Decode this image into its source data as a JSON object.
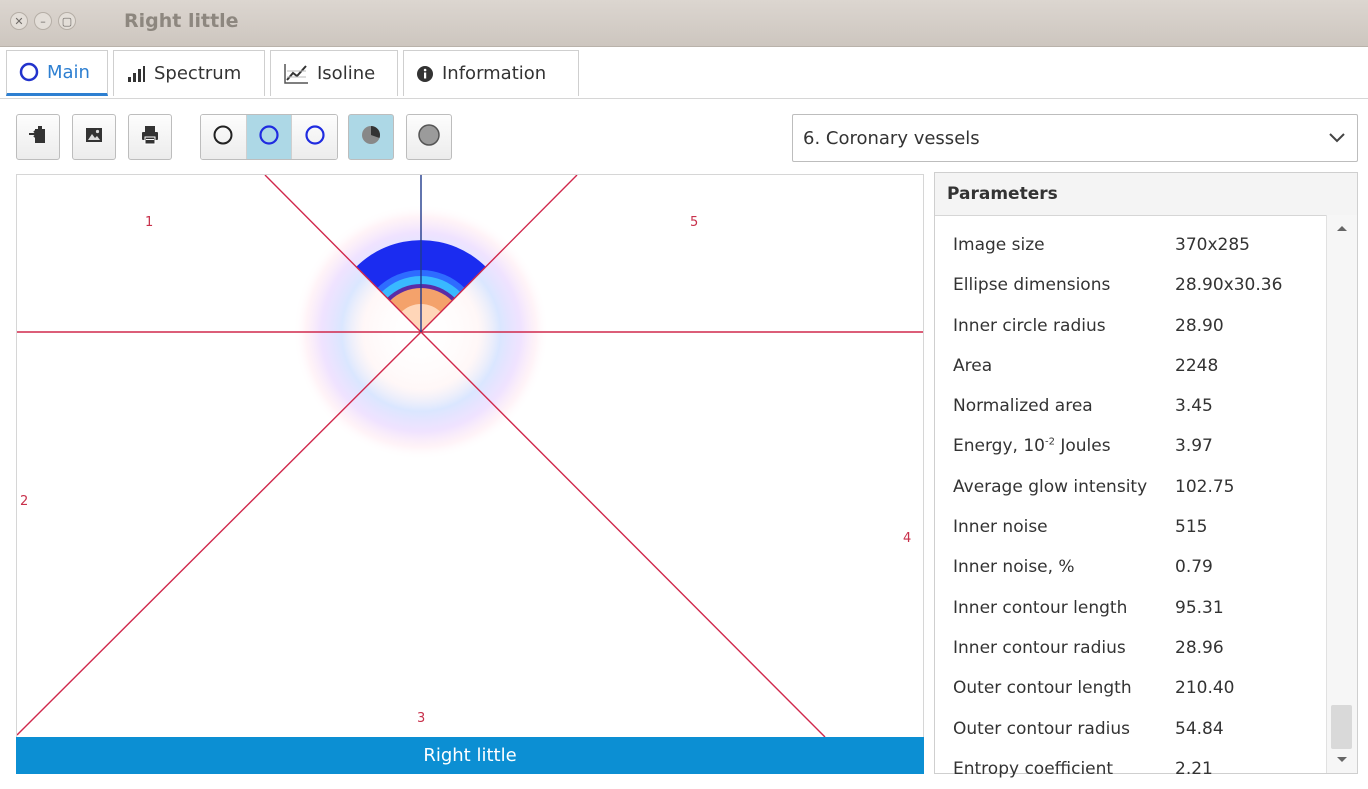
{
  "window": {
    "title": "Right little"
  },
  "tabs": [
    {
      "label": "Main",
      "icon": "circle-outline-icon",
      "active": true
    },
    {
      "label": "Spectrum",
      "icon": "bar-chart-icon",
      "active": false
    },
    {
      "label": "Isoline",
      "icon": "line-chart-icon",
      "active": false
    },
    {
      "label": "Information",
      "icon": "info-icon",
      "active": false
    }
  ],
  "toolbar": {
    "buttons": [
      "export-icon",
      "image-icon",
      "print-icon"
    ],
    "ring_modes": [
      "black-ring",
      "blue-ring-selected",
      "blue-ring"
    ],
    "toggles": [
      "pie-sector-icon",
      "filled-circle-icon"
    ]
  },
  "organ_select": {
    "value": "6. Coronary vessels"
  },
  "canvas": {
    "sector_labels": [
      "1",
      "5",
      "2",
      "4",
      "3"
    ],
    "footer_label": "Right little"
  },
  "parameters": {
    "title": "Parameters",
    "rows": [
      {
        "label": "Image size",
        "value": "370x285"
      },
      {
        "label": "Ellipse dimensions",
        "value": "28.90x30.36"
      },
      {
        "label": "Inner circle radius",
        "value": "28.90"
      },
      {
        "label": "Area",
        "value": "2248"
      },
      {
        "label": "Normalized area",
        "value": "3.45"
      },
      {
        "label": "Energy, 10",
        "label_sup": "-2",
        "label_suffix": " Joules",
        "value": "3.97"
      },
      {
        "label": "Average glow intensity",
        "value": "102.75"
      },
      {
        "label": "Inner noise",
        "value": "515"
      },
      {
        "label": "Inner noise, %",
        "value": "0.79"
      },
      {
        "label": "Inner contour length",
        "value": "95.31"
      },
      {
        "label": "Inner contour radius",
        "value": "28.96"
      },
      {
        "label": "Outer contour length",
        "value": "210.40"
      },
      {
        "label": "Outer contour radius",
        "value": "54.84"
      },
      {
        "label": "Entropy coefficient",
        "value": "2.21"
      }
    ]
  },
  "colors": {
    "accent": "#2d7fd1",
    "footer": "#0c8fd3",
    "sector_line": "#d0284c",
    "selected": "#add8e6"
  }
}
